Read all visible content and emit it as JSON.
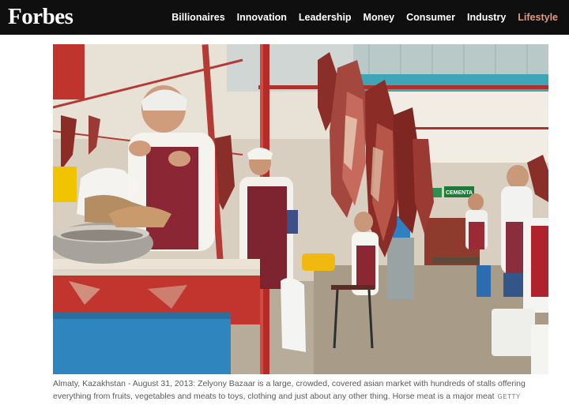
{
  "header": {
    "logo": "Forbes",
    "nav": [
      {
        "label": "Billionaires"
      },
      {
        "label": "Innovation"
      },
      {
        "label": "Leadership"
      },
      {
        "label": "Money"
      },
      {
        "label": "Consumer"
      },
      {
        "label": "Industry"
      },
      {
        "label": "Lifestyle",
        "active": true
      }
    ]
  },
  "photo": {
    "sign_text": "CEMENTA"
  },
  "caption": {
    "text": "Almaty, Kazakhstan - August 31, 2013: Zelyony Bazaar is a large, crowded, covered asian market with hundreds of stalls offering everything from fruits, vegetables and meats to toys, clothing and just about any other thing. Horse meat is a major meat",
    "credit": "GETTY"
  }
}
